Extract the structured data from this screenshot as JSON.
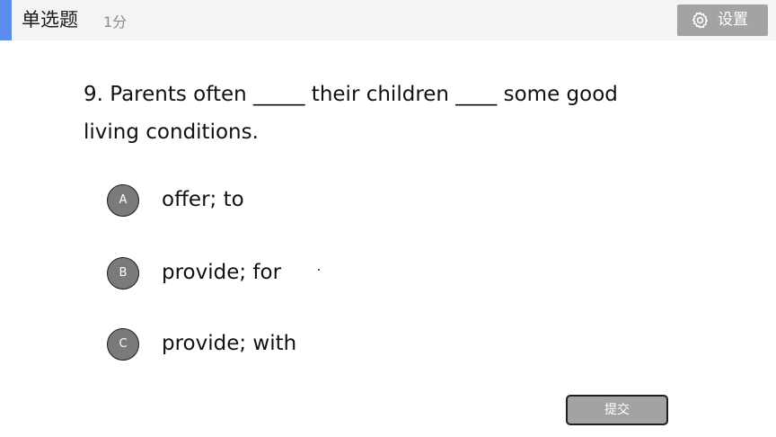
{
  "header": {
    "question_type": "单选题",
    "score": "1分",
    "settings_label": "设置",
    "accent_color": "#5b8def"
  },
  "question": {
    "stem": "9. Parents often _____ their children ____ some good living conditions.",
    "options": [
      {
        "letter": "A",
        "text": "offer; to"
      },
      {
        "letter": "B",
        "text": "provide; for"
      },
      {
        "letter": "C",
        "text": "provide; with"
      }
    ]
  },
  "footer": {
    "submit_label": "提交"
  },
  "colors": {
    "header_bg": "#f3f4f6",
    "button_bg": "#a3a3a3",
    "option_circle": "#7a7a7a"
  },
  "icons": {
    "settings": "gear-icon"
  }
}
